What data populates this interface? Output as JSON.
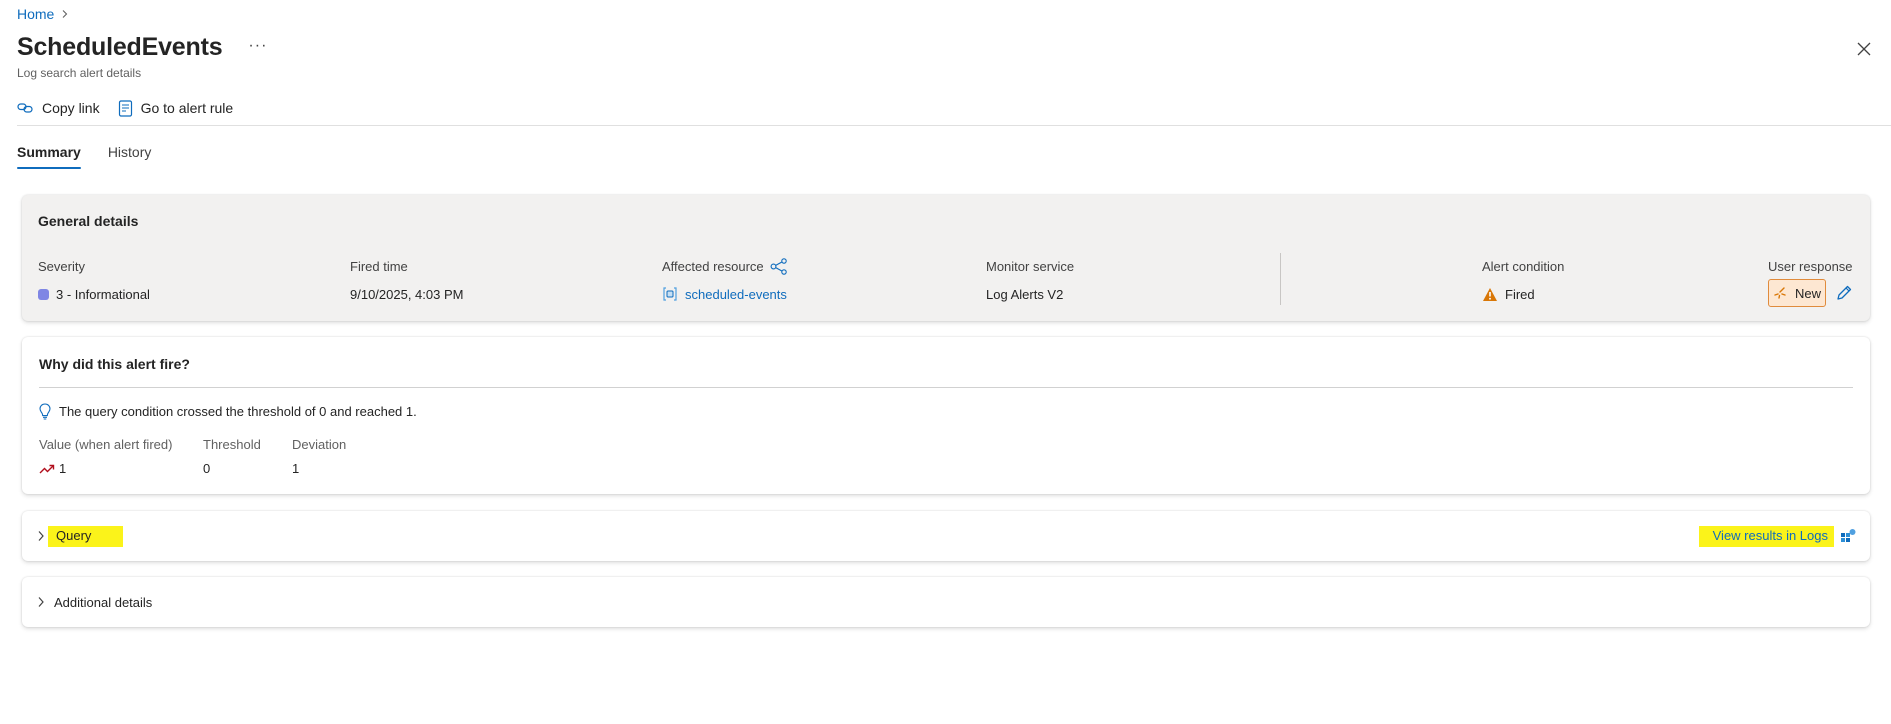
{
  "breadcrumb": {
    "home": "Home"
  },
  "header": {
    "title": "ScheduledEvents",
    "more": "···",
    "subtitle": "Log search alert details"
  },
  "toolbar": {
    "copy_link": "Copy link",
    "go_to_alert_rule": "Go to alert rule"
  },
  "tabs": [
    {
      "label": "Summary",
      "active": true
    },
    {
      "label": "History",
      "active": false
    }
  ],
  "general": {
    "title": "General details",
    "severity_label": "Severity",
    "severity_value": "3 - Informational",
    "fired_time_label": "Fired time",
    "fired_time_value": "9/10/2025, 4:03 PM",
    "affected_resource_label": "Affected resource",
    "affected_resource_value": "scheduled-events",
    "monitor_service_label": "Monitor service",
    "monitor_service_value": "Log Alerts V2",
    "alert_condition_label": "Alert condition",
    "alert_condition_value": "Fired",
    "user_response_label": "User response",
    "user_response_value": "New"
  },
  "why": {
    "title": "Why did this alert fire?",
    "condition_text": "The query condition crossed the threshold of 0 and reached 1.",
    "value_label": "Value (when alert fired)",
    "value": "1",
    "threshold_label": "Threshold",
    "threshold": "0",
    "deviation_label": "Deviation",
    "deviation": "1"
  },
  "query": {
    "label": "Query",
    "view_results": "View results in Logs"
  },
  "additional": {
    "label": "Additional details"
  },
  "colors": {
    "accent": "#0f6cbd",
    "severity": "#7f86e4",
    "warning": "#d97706",
    "new_badge_bg": "#fde7d2",
    "highlight": "#fbf31a"
  },
  "icons": [
    "chevron-right-icon",
    "close-icon",
    "link-icon",
    "alert-rule-icon",
    "share-network-icon",
    "resource-icon",
    "warning-icon",
    "new-sparkle-icon",
    "edit-pencil-icon",
    "lightbulb-icon",
    "trend-up-icon",
    "logs-icon"
  ]
}
